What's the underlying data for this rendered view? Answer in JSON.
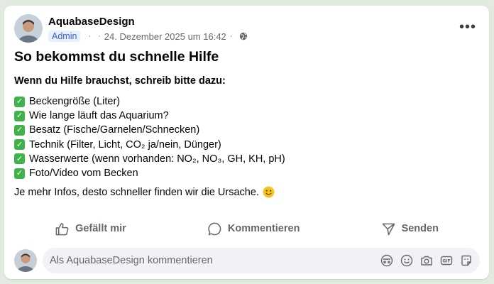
{
  "post": {
    "author": "AquabaseDesign",
    "role_badge": "Admin",
    "separator": "·",
    "timestamp": "24. Dezember 2025 um 16:42",
    "privacy_icon": "globe-icon",
    "more_icon": "more-horizontal-icon",
    "more_label": "•••",
    "title": "So bekommst du schnelle Hilfe",
    "intro": "Wenn du Hilfe brauchst, schreib bitte dazu:",
    "checklist": [
      "Beckengröße (Liter)",
      "Wie lange läuft das Aquarium?",
      "Besatz (Fische/Garnelen/Schnecken)",
      "Technik (Filter, Licht, CO₂ ja/nein, Dünger)",
      "Wasserwerte (wenn vorhanden: NO₂, NO₃, GH, KH, pH)",
      "Foto/Video vom Becken"
    ],
    "check_icon": "check-mark-emoji",
    "check_glyph": "✓",
    "outro": "Je mehr Infos, desto schneller finden wir die Ursache.",
    "outro_emoji": "slightly-smiling-face-emoji"
  },
  "actions": {
    "like_label": "Gefällt mir",
    "comment_label": "Kommentieren",
    "send_label": "Senden"
  },
  "composer": {
    "placeholder": "Als AquabaseDesign kommentieren",
    "icons": [
      "avatar-sticker-icon",
      "emoji-icon",
      "camera-icon",
      "gif-icon",
      "sticker-icon"
    ]
  },
  "colors": {
    "background": "#e3ebe1",
    "card": "#ffffff",
    "badge_bg": "#e7f0fe",
    "badge_text": "#3f5ec7",
    "check_green": "#3fb24a",
    "secondary_text": "#65676b"
  }
}
